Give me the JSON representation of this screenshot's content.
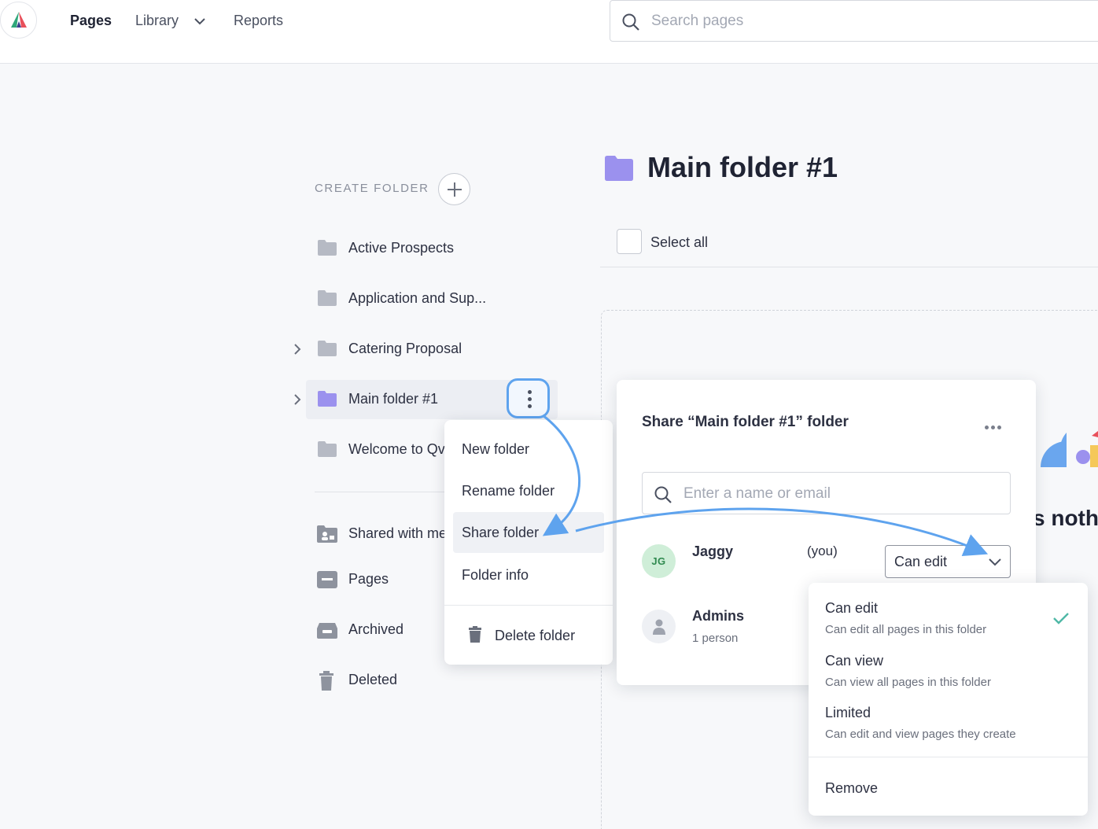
{
  "nav": {
    "pages": "Pages",
    "library": "Library",
    "reports": "Reports",
    "search_placeholder": "Search pages"
  },
  "sidebar": {
    "create_folder": "CREATE FOLDER",
    "folders": [
      {
        "label": "Active Prospects"
      },
      {
        "label": "Application and Sup..."
      },
      {
        "label": "Catering Proposal"
      },
      {
        "label": "Main folder #1"
      },
      {
        "label": "Welcome to Qv"
      }
    ],
    "links": [
      {
        "label": "Shared with me",
        "icon": "shared-folder-icon"
      },
      {
        "label": "Pages",
        "icon": "pages-icon"
      },
      {
        "label": "Archived",
        "icon": "archive-icon"
      },
      {
        "label": "Deleted",
        "icon": "trash-icon"
      }
    ]
  },
  "main": {
    "title": "Main folder #1",
    "select_all": "Select all",
    "empty_text": "s nothi"
  },
  "context_menu": {
    "items": [
      "New folder",
      "Rename folder",
      "Share folder",
      "Folder info"
    ],
    "delete": "Delete folder"
  },
  "share_panel": {
    "title": "Share “Main folder #1” folder",
    "input_placeholder": "Enter a name or email",
    "user": {
      "initials": "JG",
      "name": "Jaggy",
      "you": "(you)",
      "permission": "Can edit"
    },
    "group": {
      "name": "Admins",
      "count": "1 person"
    }
  },
  "permission_menu": {
    "options": [
      {
        "title": "Can edit",
        "desc": "Can edit all pages in this folder",
        "selected": true
      },
      {
        "title": "Can view",
        "desc": "Can view all pages in this folder",
        "selected": false
      },
      {
        "title": "Limited",
        "desc": "Can edit and view pages they create",
        "selected": false
      }
    ],
    "remove": "Remove"
  },
  "colors": {
    "accent_blue": "#5ea3ee",
    "folder_purple": "#9b91ee",
    "folder_gray": "#b6bac4",
    "check_teal": "#4fb8a6"
  }
}
